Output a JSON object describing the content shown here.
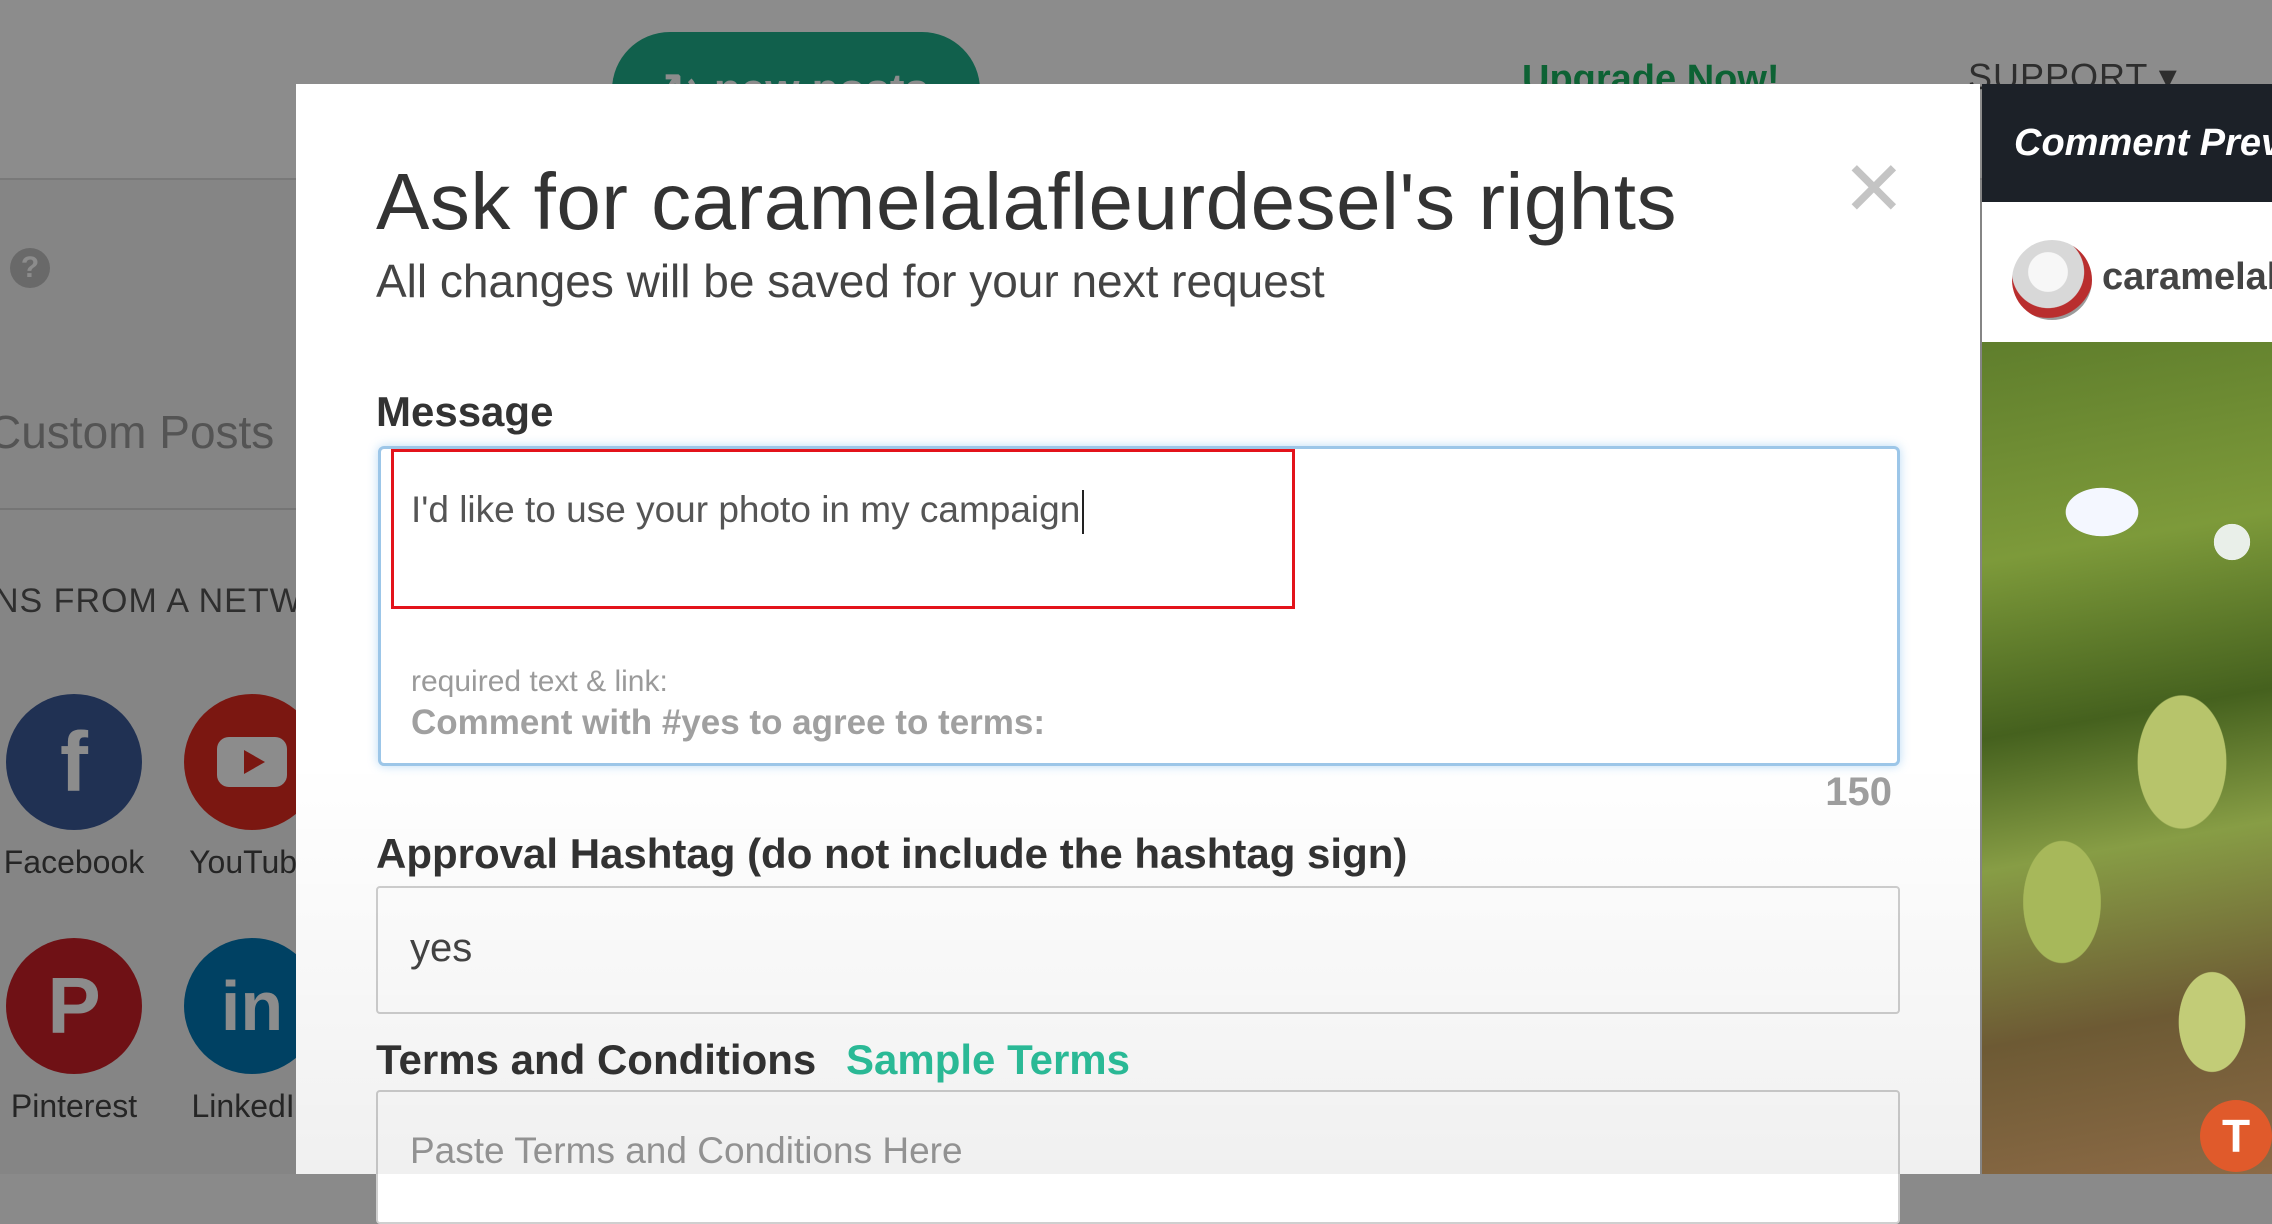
{
  "background": {
    "new_posts_label": "new posts",
    "upgrade_label": "Upgrade Now!",
    "support_label": "SUPPORT ▾",
    "help_icon": "?",
    "custom_posts_label": "Custom Posts",
    "network_heading": "NS FROM A NETWORK",
    "networks": [
      {
        "label": "Facebook",
        "color": "#3b5998"
      },
      {
        "label": "YouTube",
        "color": "#e02a20"
      },
      {
        "label": "Pinterest",
        "color": "#cb2027"
      },
      {
        "label": "LinkedIn",
        "color": "#0077b5"
      }
    ]
  },
  "modal": {
    "title": "Ask for caramelalafleurdesel's rights",
    "subtitle": "All changes will be saved for your next request",
    "close_symbol": "✕",
    "message_label": "Message",
    "message_value": "I'd like to use your photo in my campaign",
    "required_label": "required text & link:",
    "required_text": "Comment with #yes to agree to terms:",
    "char_count": "150",
    "hashtag_label": "Approval Hashtag (do not include the hashtag sign)",
    "hashtag_value": "yes",
    "terms_label": "Terms and Conditions",
    "sample_terms_label": "Sample Terms",
    "terms_placeholder": "Paste Terms and Conditions Here"
  },
  "preview": {
    "title": "Comment Preview",
    "username": "caramelalafleurdesel"
  },
  "colors": {
    "accent_green": "#1fb08a",
    "sample_terms": "#2cc19c",
    "highlight_red": "#e3131b",
    "preview_header": "#1c2128"
  }
}
